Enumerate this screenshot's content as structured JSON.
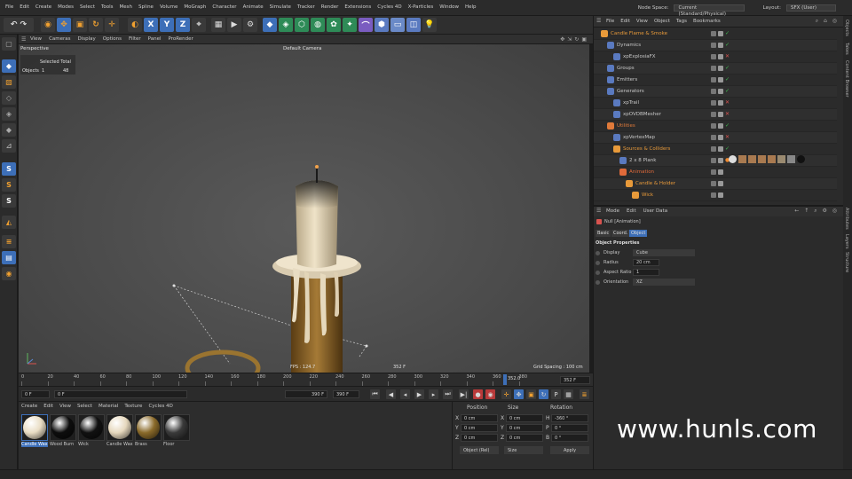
{
  "menubar": {
    "items": [
      "File",
      "Edit",
      "Create",
      "Modes",
      "Select",
      "Tools",
      "Mesh",
      "Spline",
      "Volume",
      "MoGraph",
      "Character",
      "Animate",
      "Simulate",
      "Tracker",
      "Render",
      "Extensions",
      "Cycles 4D",
      "X-Particles",
      "Window",
      "Help"
    ],
    "node_space_label": "Node Space:",
    "node_space_value": "Current (Standard/Physical)",
    "layout_label": "Layout:",
    "layout_value": "SFX (User)"
  },
  "viewport": {
    "menu": [
      "View",
      "Cameras",
      "Display",
      "Options",
      "Filter",
      "Panel",
      "ProRender"
    ],
    "name": "Perspective",
    "camera": "Default Camera",
    "selected_total_header": "Selected Total",
    "objects_label": "Objects",
    "objects_selected": "1",
    "objects_total": "48",
    "fps": "FPS : 124.7",
    "frame": "352 F",
    "grid_spacing": "Grid Spacing : 100 cm"
  },
  "timeline": {
    "ticks": [
      "0",
      "20",
      "40",
      "60",
      "80",
      "100",
      "120",
      "140",
      "160",
      "180",
      "200",
      "220",
      "240",
      "260",
      "280",
      "300",
      "320",
      "340",
      "360",
      "380"
    ],
    "current_frame_marker": "352.0",
    "end_field": "352 F"
  },
  "transport": {
    "start": "0 F",
    "min": "0 F",
    "max": "390 F",
    "end": "390 F"
  },
  "materials": {
    "menu": [
      "Create",
      "Edit",
      "View",
      "Select",
      "Material",
      "Texture",
      "Cycles 4D"
    ],
    "items": [
      {
        "name": "Candle Wax",
        "color": "#e9ddc4"
      },
      {
        "name": "Wood Burn",
        "color": "#0d0d0d"
      },
      {
        "name": "Wick",
        "color": "#111111"
      },
      {
        "name": "Candle Wax",
        "color": "#e6d8bd"
      },
      {
        "name": "Brass",
        "color": "#8a6a2a"
      },
      {
        "name": "Floor",
        "color": "#3a3a3a"
      }
    ]
  },
  "coordinates": {
    "headers": [
      "Position",
      "Size",
      "Rotation"
    ],
    "rows": [
      {
        "axis": "X",
        "pos": "0 cm",
        "size_axis": "X",
        "size": "0 cm",
        "rot_axis": "H",
        "rot": "-360 °"
      },
      {
        "axis": "Y",
        "pos": "0 cm",
        "size_axis": "Y",
        "size": "0 cm",
        "rot_axis": "P",
        "rot": "0 °"
      },
      {
        "axis": "Z",
        "pos": "0 cm",
        "size_axis": "Z",
        "size": "0 cm",
        "rot_axis": "B",
        "rot": "0 °"
      }
    ],
    "mode": "Object (Rel)",
    "size_mode": "Size",
    "apply": "Apply"
  },
  "object_manager": {
    "menu": [
      "File",
      "Edit",
      "View",
      "Object",
      "Tags",
      "Bookmarks"
    ],
    "rows": [
      {
        "name": "Candle Flame & Smoke",
        "indent": 0,
        "color": "#e89a3a",
        "status": "ok"
      },
      {
        "name": "Dynamics",
        "indent": 1,
        "color": "#c8c8c8",
        "status": "ok"
      },
      {
        "name": "xpExplosiaFX",
        "indent": 2,
        "color": "#c8c8c8",
        "status": "off"
      },
      {
        "name": "Groups",
        "indent": 1,
        "color": "#c8c8c8",
        "status": "ok"
      },
      {
        "name": "Emitters",
        "indent": 1,
        "color": "#c8c8c8",
        "status": "ok"
      },
      {
        "name": "Generators",
        "indent": 1,
        "color": "#c8c8c8",
        "status": "ok"
      },
      {
        "name": "xpTrail",
        "indent": 2,
        "color": "#c8c8c8",
        "status": "off"
      },
      {
        "name": "xpOVDBMesher",
        "indent": 2,
        "color": "#c8c8c8",
        "status": "off"
      },
      {
        "name": "Utilities",
        "indent": 1,
        "color": "#e07a3a",
        "status": "ok"
      },
      {
        "name": "xpVertexMap",
        "indent": 2,
        "color": "#c8c8c8",
        "status": "off"
      },
      {
        "name": "Sources & Colliders",
        "indent": 2,
        "color": "#e89a3a",
        "status": "ok"
      },
      {
        "name": "2 x 8 Plank",
        "indent": 3,
        "color": "#c8c8c8",
        "status": "dot"
      },
      {
        "name": "Animation",
        "indent": 3,
        "color": "#e06a3a",
        "status": "none"
      },
      {
        "name": "Candle & Holder",
        "indent": 4,
        "color": "#e89a3a",
        "status": "none"
      },
      {
        "name": "Wick",
        "indent": 5,
        "color": "#e89a3a",
        "status": "none"
      }
    ]
  },
  "attributes": {
    "menu": [
      "Mode",
      "Edit",
      "User Data"
    ],
    "object_name": "Null [Animation]",
    "tabs": [
      "Basic",
      "Coord.",
      "Object"
    ],
    "section_title": "Object Properties",
    "props": [
      {
        "label": "Display",
        "value": "Cube"
      },
      {
        "label": "Radius",
        "value": "20 cm"
      },
      {
        "label": "Aspect Ratio",
        "value": "1"
      },
      {
        "label": "Orientation",
        "value": "XZ"
      }
    ]
  },
  "side_tabs": [
    "Objects",
    "Takes",
    "Content Browser",
    "Attributes",
    "Layers",
    "Structure"
  ],
  "watermark": "www.hunls.com",
  "colors": {
    "accent_blue": "#3d6fb8",
    "ok_green": "#3fb950",
    "off_red": "#d9534f",
    "orange_label": "#e89a3a"
  }
}
